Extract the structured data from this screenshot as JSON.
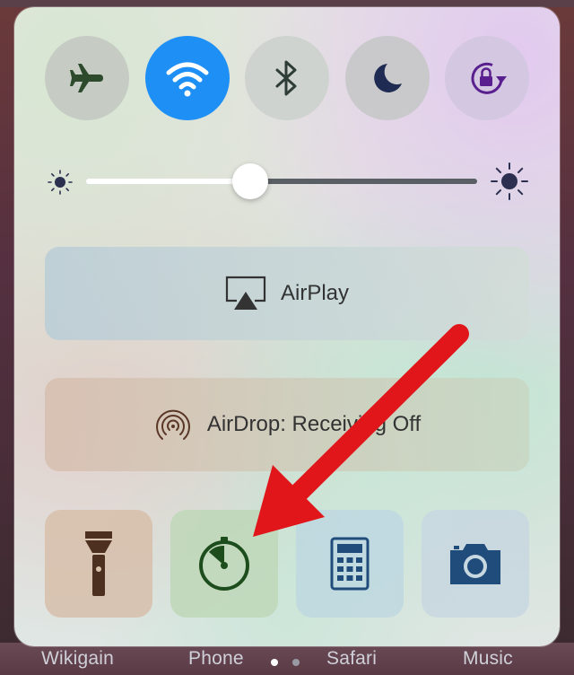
{
  "control_center": {
    "toggles": [
      {
        "name": "airplane-mode",
        "icon": "airplane-icon",
        "active": false,
        "bg": "#c6ccc4",
        "fg": "#2d4a2d"
      },
      {
        "name": "wifi",
        "icon": "wifi-icon",
        "active": true,
        "bg": "#1e8ff5",
        "fg": "#ffffff"
      },
      {
        "name": "bluetooth",
        "icon": "bluetooth-icon",
        "active": false,
        "bg": "#cfd3d0",
        "fg": "#2f3d38"
      },
      {
        "name": "do-not-disturb",
        "icon": "moon-icon",
        "active": false,
        "bg": "#c9c9cc",
        "fg": "#1f2b52"
      },
      {
        "name": "rotation-lock",
        "icon": "rotation-lock-icon",
        "active": false,
        "bg": "#d4c7e2",
        "fg": "#5a1f8e"
      }
    ],
    "brightness": {
      "level": 0.42,
      "min_icon": "sun-small-icon",
      "max_icon": "sun-large-icon"
    },
    "airplay": {
      "label": "AirPlay",
      "icon": "airplay-icon"
    },
    "airdrop": {
      "label": "AirDrop: Receiving Off",
      "icon": "airdrop-icon"
    },
    "shortcuts": [
      {
        "name": "flashlight",
        "icon": "flashlight-icon"
      },
      {
        "name": "timer",
        "icon": "timer-icon"
      },
      {
        "name": "calculator",
        "icon": "calculator-icon"
      },
      {
        "name": "camera",
        "icon": "camera-icon"
      }
    ]
  },
  "dock": {
    "labels": [
      "Wikigain",
      "Phone",
      "Safari",
      "Music"
    ],
    "page_dots": 2,
    "active_page": 0
  },
  "annotation": {
    "icon": "red-arrow-icon",
    "color": "#e0161b"
  }
}
